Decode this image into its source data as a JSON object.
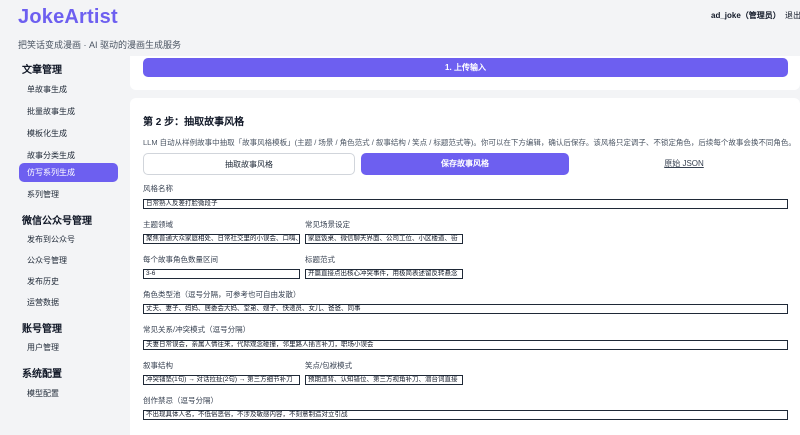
{
  "app": {
    "title": "JokeArtist",
    "tagline": "把笑话变成漫画 · AI 驱动的漫画生成服务",
    "user": "ad_joke（管理员）",
    "logout": "退出"
  },
  "sidebar": {
    "groups": [
      {
        "label": "文章管理",
        "items": [
          "单故事生成",
          "批量故事生成",
          "模板化生成",
          "故事分类生成",
          "仿写系列生成",
          "系列管理"
        ]
      },
      {
        "label": "微信公众号管理",
        "items": [
          "发布到公众号",
          "公众号管理",
          "发布历史",
          "运营数据"
        ]
      },
      {
        "label": "账号管理",
        "items": [
          "用户管理"
        ]
      },
      {
        "label": "系统配置",
        "items": [
          "模型配置"
        ]
      }
    ],
    "active_item": "仿写系列生成"
  },
  "step1": {
    "button_label": "1. 上传输入"
  },
  "step2": {
    "title": "第 2 步：抽取故事风格",
    "description": "LLM 自动从样例故事中抽取「故事风格模板」(主题 / 场景 / 角色范式 / 叙事结构 / 笑点 / 标题范式等)。你可以在下方编辑，确认后保存。该风格只定调子、不锁定角色，后续每个故事会换不同角色。",
    "buttons": {
      "extract": "抽取故事风格",
      "save": "保存故事风格",
      "json": "原始 JSON"
    },
    "fields": {
      "style_name": {
        "label": "风格名称",
        "value": "日常熟人反差打脸微段子"
      },
      "theme": {
        "label": "主题领域",
        "value": "聚焦普通大众家庭相处、日常社交里的小误会、口嗨、"
      },
      "scene": {
        "label": "常见场景设定",
        "value": "家庭饭桌、微信聊天界面、公司工位、小区楼道、街"
      },
      "role_count": {
        "label": "每个故事角色数量区间",
        "value": "3-6"
      },
      "title_pattern": {
        "label": "标题范式",
        "value": "开篇直接点出核心冲突事件，用极简表述留反转悬念"
      },
      "role_pool": {
        "label": "角色类型池（逗号分隔，可参考也可自由发散）",
        "value": "丈夫、妻子、妈妈、居委会大妈、堂弟、嫂子、快递员、女儿、爸爸、同事"
      },
      "relations": {
        "label": "常见关系/冲突模式（逗号分隔）",
        "value": "夫妻日常误会，亲属人情往来，代际观念碰撞，邻里路人插言补刀，职场小误会"
      },
      "structure": {
        "label": "叙事结构",
        "value": "冲突铺垫(1句) → 对话拉扯(2句) → 第三方细节补刀"
      },
      "humor": {
        "label": "笑点/包袱模式",
        "value": "预期违背、认知错位、第三方视角补刀、潜台词直接"
      },
      "taboo": {
        "label": "创作禁忌（逗号分隔）",
        "value": "不出现具体人名，不低俗恶俗，不涉及敏感内容，不刻意制造对立引战"
      }
    }
  }
}
